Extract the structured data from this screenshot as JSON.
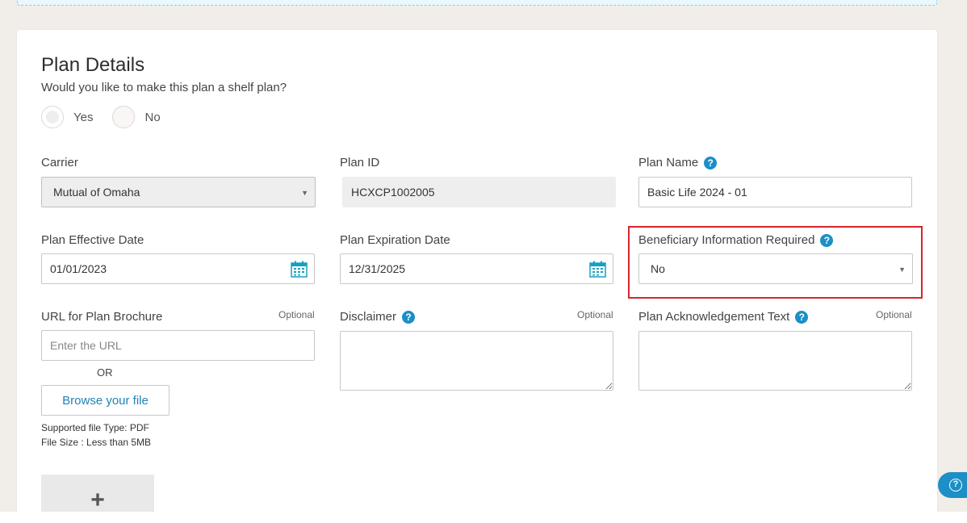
{
  "card": {
    "title": "Plan Details",
    "shelf_question": "Would you like to make this plan a shelf plan?",
    "radio_yes": "Yes",
    "radio_no": "No"
  },
  "carrier": {
    "label": "Carrier",
    "value": "Mutual of Omaha"
  },
  "plan_id": {
    "label": "Plan ID",
    "value": "HCXCP1002005"
  },
  "plan_name": {
    "label": "Plan Name",
    "value": "Basic Life 2024 - 01"
  },
  "effective_date": {
    "label": "Plan Effective Date",
    "value": "01/01/2023"
  },
  "expiration_date": {
    "label": "Plan Expiration Date",
    "value": "12/31/2025"
  },
  "beneficiary": {
    "label": "Beneficiary Information Required",
    "value": "No"
  },
  "brochure": {
    "label": "URL for Plan Brochure",
    "optional": "Optional",
    "placeholder": "Enter the URL",
    "or": "OR",
    "browse_label": "Browse your file",
    "file_type_note": "Supported file Type: PDF",
    "file_size_note": "File Size : Less than 5MB"
  },
  "disclaimer": {
    "label": "Disclaimer",
    "optional": "Optional"
  },
  "acknowledgement": {
    "label": "Plan Acknowledgement Text",
    "optional": "Optional"
  },
  "icons": {
    "help": "?",
    "plus": "+",
    "help_fab": "?"
  },
  "colors": {
    "accent": "#1b8fc6",
    "highlight": "#d9232d"
  }
}
